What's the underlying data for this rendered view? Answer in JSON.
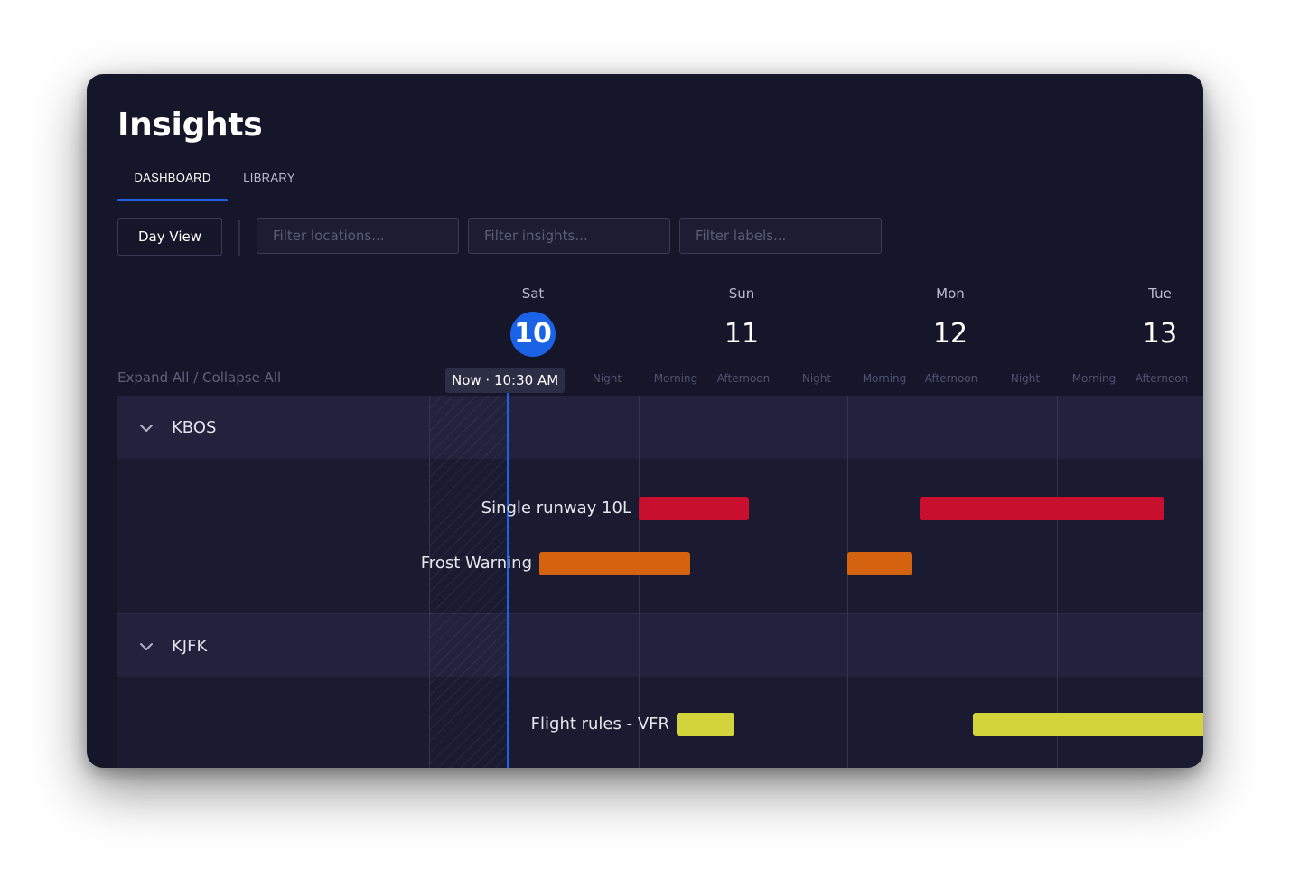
{
  "app": {
    "title": "Insights",
    "tabs": [
      {
        "label": "DASHBOARD",
        "active": true
      },
      {
        "label": "LIBRARY",
        "active": false
      }
    ]
  },
  "toolbar": {
    "view_button": "Day View",
    "filters": [
      {
        "placeholder": "Filter locations...",
        "value": ""
      },
      {
        "placeholder": "Filter insights...",
        "value": ""
      },
      {
        "placeholder": "Filter labels...",
        "value": ""
      }
    ]
  },
  "timeline": {
    "expand_collapse": "Expand All / Collapse All",
    "days": [
      {
        "name": "Sat",
        "number": "10",
        "today": true
      },
      {
        "name": "Sun",
        "number": "11",
        "today": false
      },
      {
        "name": "Mon",
        "number": "12",
        "today": false
      },
      {
        "name": "Tue",
        "number": "13",
        "today": false
      }
    ],
    "periods": [
      "Night",
      "Morning",
      "Afternoon",
      "Night",
      "Morning",
      "Afternoon",
      "Night",
      "Morning",
      "Afternoon"
    ],
    "now_label": "Now · 10:30 AM"
  },
  "groups": [
    {
      "name": "KBOS",
      "insights": [
        {
          "label": "Single runway 10L",
          "color": "#c8102e"
        },
        {
          "label": "Frost Warning",
          "color": "#d5620f"
        }
      ]
    },
    {
      "name": "KJFK",
      "insights": [
        {
          "label": "Flight rules - VFR",
          "color": "#d3d33c"
        }
      ]
    }
  ],
  "colors": {
    "accent": "#1a63e6",
    "background": "#15162a",
    "group_header": "#23223d"
  },
  "icons": {
    "collapse": "chevron-down-icon"
  }
}
